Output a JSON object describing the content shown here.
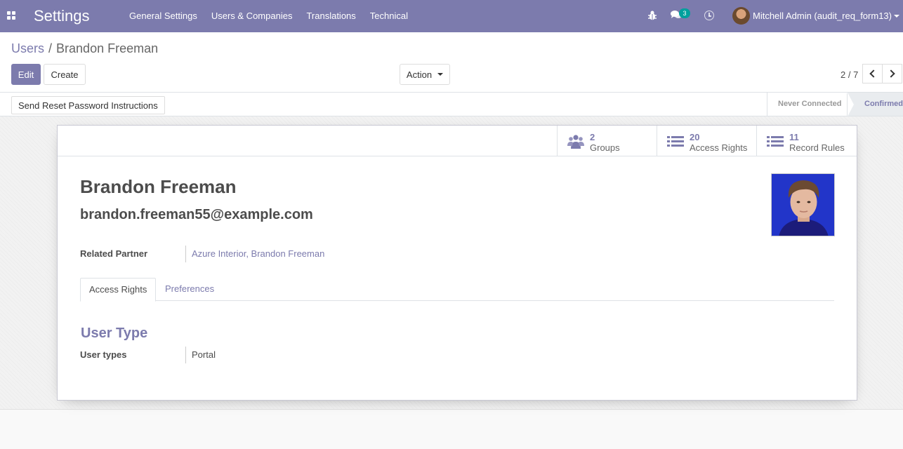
{
  "navbar": {
    "app_title": "Settings",
    "menu": [
      "General Settings",
      "Users & Companies",
      "Translations",
      "Technical"
    ],
    "chat_badge": "3",
    "user_label": "Mitchell Admin (audit_req_form13)"
  },
  "breadcrumb": {
    "parent": "Users",
    "current": "Brandon Freeman"
  },
  "buttons": {
    "edit": "Edit",
    "create": "Create",
    "action": "Action"
  },
  "pager": {
    "value": "2 / 7"
  },
  "statusbar": {
    "reset_button": "Send Reset Password Instructions",
    "steps": [
      "Never Connected",
      "Confirmed"
    ],
    "active_step": "Confirmed"
  },
  "stat_buttons": [
    {
      "value": "2",
      "label": "Groups",
      "icon": "users-icon"
    },
    {
      "value": "20",
      "label": "Access Rights",
      "icon": "list-icon"
    },
    {
      "value": "11",
      "label": "Record Rules",
      "icon": "list-icon"
    }
  ],
  "form": {
    "name": "Brandon Freeman",
    "login": "brandon.freeman55@example.com",
    "related_partner_label": "Related Partner",
    "related_partner_value": "Azure Interior, Brandon Freeman",
    "tabs": [
      "Access Rights",
      "Preferences"
    ],
    "active_tab": "Access Rights",
    "group_title": "User Type",
    "user_types_label": "User types",
    "user_types_value": "Portal"
  },
  "colors": {
    "brand": "#7c7bad",
    "badge": "#00a09d"
  }
}
